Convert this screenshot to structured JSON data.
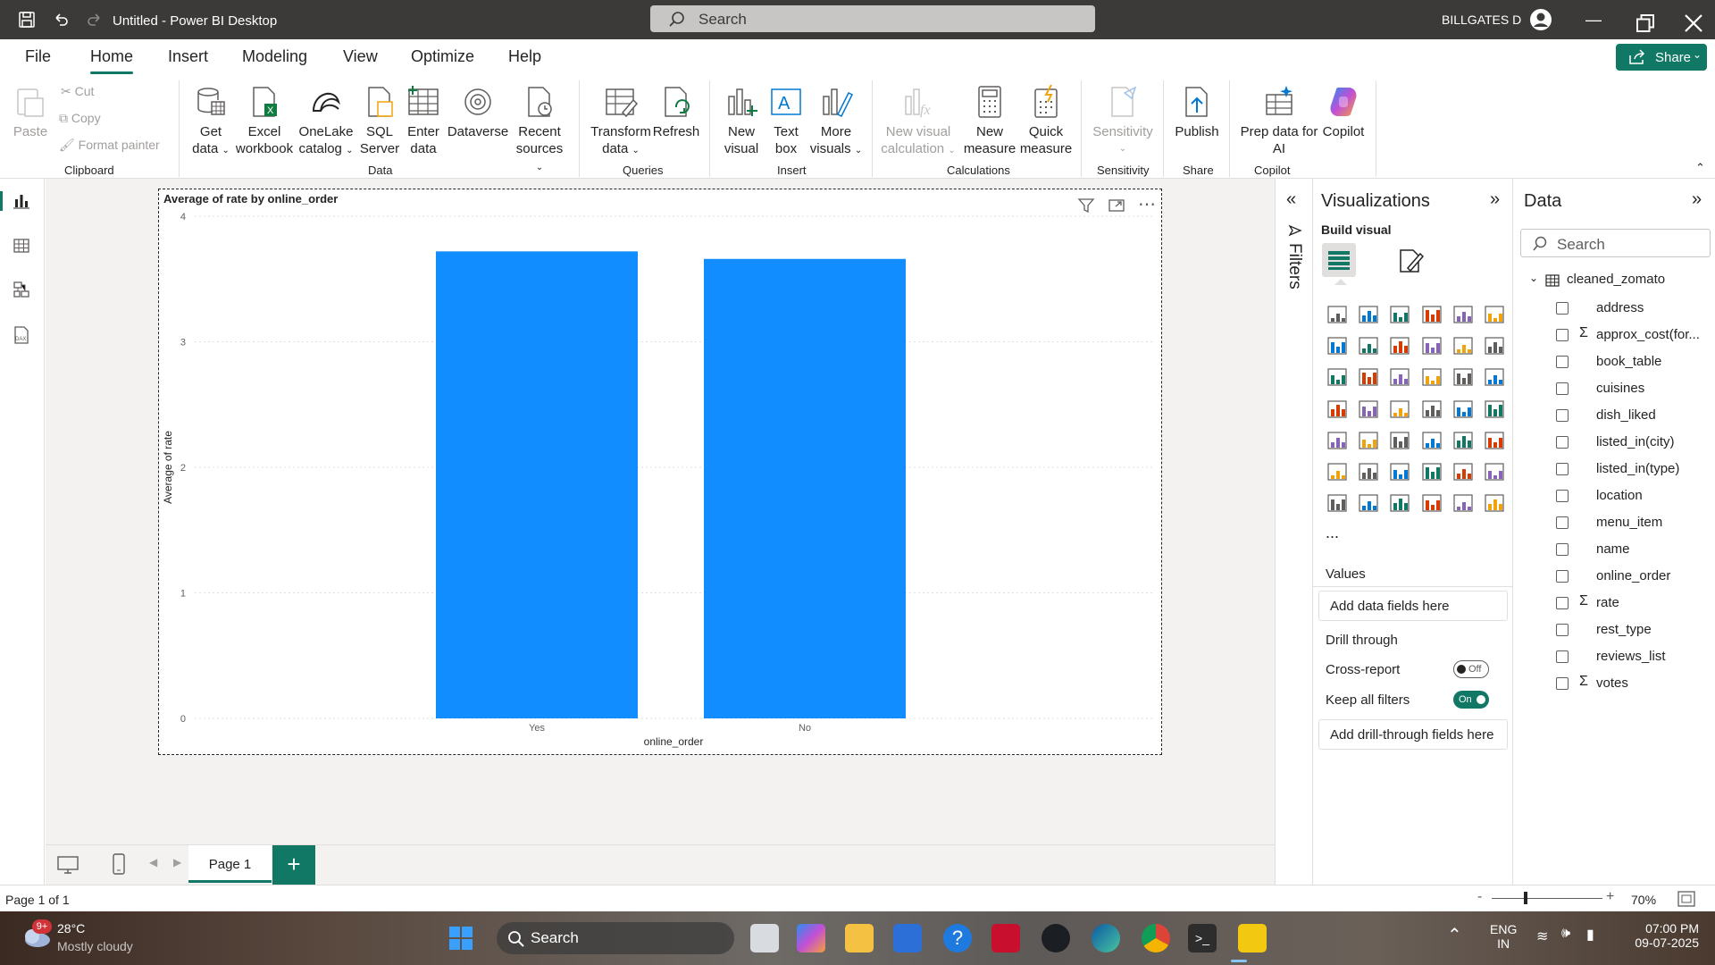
{
  "window": {
    "title": "Untitled - Power BI Desktop",
    "search_placeholder": "Search",
    "user": "BILLGATES D"
  },
  "menu": {
    "items": [
      "File",
      "Home",
      "Insert",
      "Modeling",
      "View",
      "Optimize",
      "Help"
    ],
    "active": "Home",
    "share_label": "Share"
  },
  "ribbon": {
    "clipboard": {
      "paste": "Paste",
      "cut": "Cut",
      "copy": "Copy",
      "format_painter": "Format painter",
      "group": "Clipboard"
    },
    "data": {
      "get_data": [
        "Get",
        "data"
      ],
      "excel": [
        "Excel",
        "workbook"
      ],
      "onelake": [
        "OneLake",
        "catalog"
      ],
      "sql": [
        "SQL",
        "Server"
      ],
      "enter": [
        "Enter",
        "data"
      ],
      "dataverse": "Dataverse",
      "recent": [
        "Recent",
        "sources"
      ],
      "group": "Data"
    },
    "queries": {
      "transform": [
        "Transform",
        "data"
      ],
      "refresh": "Refresh",
      "group": "Queries"
    },
    "insert": {
      "new_visual": [
        "New",
        "visual"
      ],
      "text_box": [
        "Text",
        "box"
      ],
      "more_visuals": [
        "More",
        "visuals"
      ],
      "group": "Insert"
    },
    "calculations": {
      "new_visual_calc": [
        "New visual",
        "calculation"
      ],
      "new_measure": [
        "New",
        "measure"
      ],
      "quick_measure": [
        "Quick",
        "measure"
      ],
      "group": "Calculations"
    },
    "sensitivity": {
      "label": "Sensitivity",
      "group": "Sensitivity"
    },
    "share": {
      "publish": "Publish",
      "group": "Share"
    },
    "copilot": {
      "prep": [
        "Prep data for",
        "AI"
      ],
      "copilot": "Copilot",
      "group": "Copilot"
    }
  },
  "chart_data": {
    "type": "bar",
    "title": "Average of rate by online_order",
    "categories": [
      "Yes",
      "No"
    ],
    "values": [
      3.72,
      3.66
    ],
    "xlabel": "online_order",
    "ylabel": "Average of rate",
    "yticks": [
      "0",
      "1",
      "2",
      "3",
      "4"
    ],
    "ylim": [
      0,
      4
    ],
    "bar_color": "#118dff",
    "grid": true
  },
  "pages": {
    "tab": "Page 1",
    "status": "Page 1 of 1",
    "zoom": "70%"
  },
  "filters": {
    "label": "Filters"
  },
  "visualizations": {
    "title": "Visualizations",
    "build_label": "Build visual",
    "values_label": "Values",
    "values_placeholder": "Add data fields here",
    "drill_label": "Drill through",
    "cross_report": "Cross-report",
    "cross_report_state": "Off",
    "keep_filters": "Keep all filters",
    "keep_filters_state": "On",
    "drill_placeholder": "Add drill-through fields here",
    "more": "..."
  },
  "data_pane": {
    "title": "Data",
    "search_placeholder": "Search",
    "table": "cleaned_zomato",
    "fields": [
      {
        "name": "address",
        "sigma": ""
      },
      {
        "name": "approx_cost(for...",
        "sigma": "Σ"
      },
      {
        "name": "book_table",
        "sigma": ""
      },
      {
        "name": "cuisines",
        "sigma": ""
      },
      {
        "name": "dish_liked",
        "sigma": ""
      },
      {
        "name": "listed_in(city)",
        "sigma": ""
      },
      {
        "name": "listed_in(type)",
        "sigma": ""
      },
      {
        "name": "location",
        "sigma": ""
      },
      {
        "name": "menu_item",
        "sigma": ""
      },
      {
        "name": "name",
        "sigma": ""
      },
      {
        "name": "online_order",
        "sigma": ""
      },
      {
        "name": "rate",
        "sigma": "Σ"
      },
      {
        "name": "rest_type",
        "sigma": ""
      },
      {
        "name": "reviews_list",
        "sigma": ""
      },
      {
        "name": "votes",
        "sigma": "Σ"
      }
    ]
  },
  "taskbar": {
    "weather_temp": "28°C",
    "weather_desc": "Mostly cloudy",
    "weather_badge": "9+",
    "search_label": "Search",
    "lang": [
      "ENG",
      "IN"
    ],
    "time": "07:00 PM",
    "date": "09-07-2025"
  }
}
